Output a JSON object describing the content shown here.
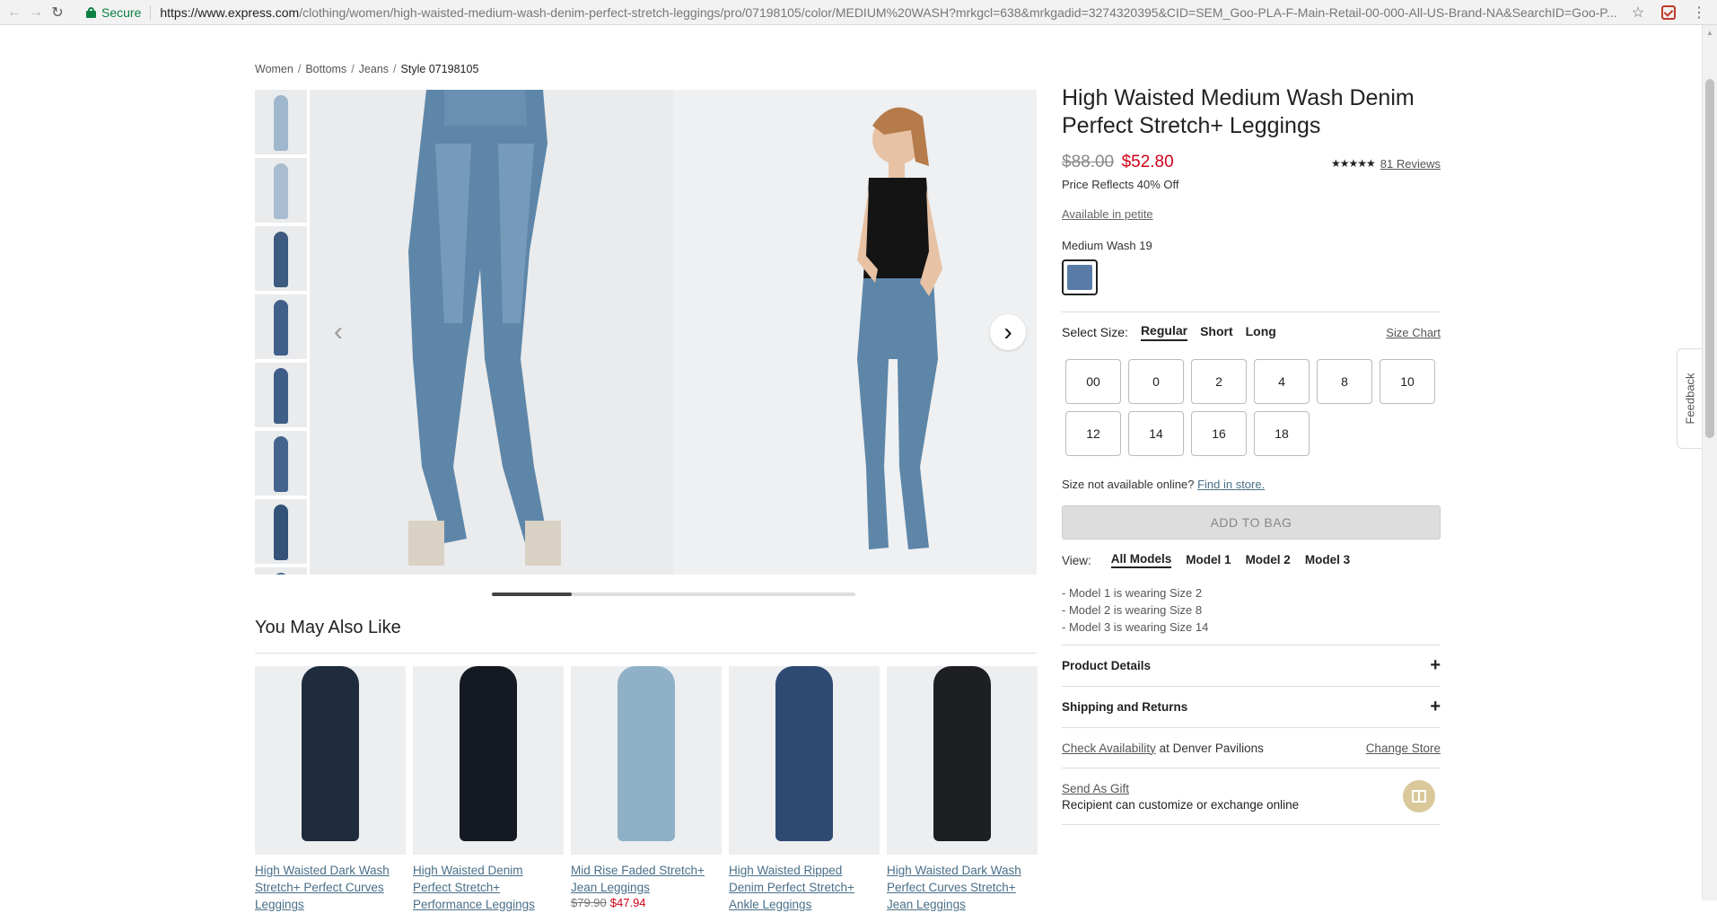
{
  "browser": {
    "secure_label": "Secure",
    "url_host": "https://www.express.com",
    "url_rest": "/clothing/women/high-waisted-medium-wash-denim-perfect-stretch-leggings/pro/07198105/color/MEDIUM%20WASH?mrkgcl=638&mrkgadid=3274320395&CID=SEM_Goo-PLA-F-Main-Retail-00-000-All-US-Brand-NA&SearchID=Goo-P..."
  },
  "breadcrumb": {
    "items": [
      "Women",
      "Bottoms",
      "Jeans"
    ],
    "current": "Style 07198105"
  },
  "product": {
    "title": "High Waisted Medium Wash Denim Perfect Stretch+ Leggings",
    "price_old": "$88.00",
    "price_new": "$52.80",
    "rating_stars": "★★★★★",
    "rating_value": 4.5,
    "reviews": "81 Reviews",
    "discount_note": "Price Reflects 40% Off",
    "petite_link": "Available in petite",
    "color_name": "Medium Wash 19",
    "swatch_color": "#5a7ba8"
  },
  "size": {
    "label": "Select Size:",
    "fits": [
      "Regular",
      "Short",
      "Long"
    ],
    "active_fit": "Regular",
    "chart_link": "Size Chart",
    "options": [
      "00",
      "0",
      "2",
      "4",
      "8",
      "10",
      "12",
      "14",
      "16",
      "18"
    ],
    "not_available": "Size not available online?",
    "find_in_store": "Find in store."
  },
  "add_to_bag": "ADD TO BAG",
  "view": {
    "label": "View:",
    "models": [
      "All Models",
      "Model 1",
      "Model 2",
      "Model 3"
    ],
    "wearing": [
      "- Model 1 is wearing Size 2",
      "- Model 2 is wearing Size 8",
      "- Model 3 is wearing Size 14"
    ]
  },
  "accordions": [
    "Product Details",
    "Shipping and Returns"
  ],
  "store": {
    "check_link": "Check Availability",
    "location": " at Denver Pavilions",
    "change_link": "Change Store"
  },
  "gift": {
    "link": "Send As Gift",
    "sub": "Recipient can customize or exchange online"
  },
  "gallery": {
    "prev_glyph": "‹",
    "next_glyph": "›",
    "progress": 0.22
  },
  "ymal": {
    "title": "You May Also Like",
    "items": [
      {
        "name": "High Waisted Dark Wash Stretch+ Perfect Curves Leggings",
        "old": "",
        "new": "",
        "color": "#1f2c3e"
      },
      {
        "name": "High Waisted Denim Perfect Stretch+ Performance Leggings",
        "old": "",
        "new": "",
        "color": "#151a22"
      },
      {
        "name": "Mid Rise Faded Stretch+ Jean Leggings",
        "old": "$79.90",
        "new": "$47.94",
        "color": "#8fb0c6"
      },
      {
        "name": "High Waisted Ripped Denim Perfect Stretch+ Ankle Leggings",
        "old": "",
        "new": "",
        "color": "#2f4a72"
      },
      {
        "name": "High Waisted Dark Wash Perfect Curves Stretch+ Jean Leggings",
        "old": "",
        "new": "",
        "color": "#1d1f22"
      }
    ]
  },
  "feedback": "Feedback",
  "thumb_colors": [
    "#9fb7cc",
    "#a9bdd0",
    "#3d5a80",
    "#40608a",
    "#3f5e87",
    "#44648e",
    "#355378",
    "#4a6a94"
  ]
}
